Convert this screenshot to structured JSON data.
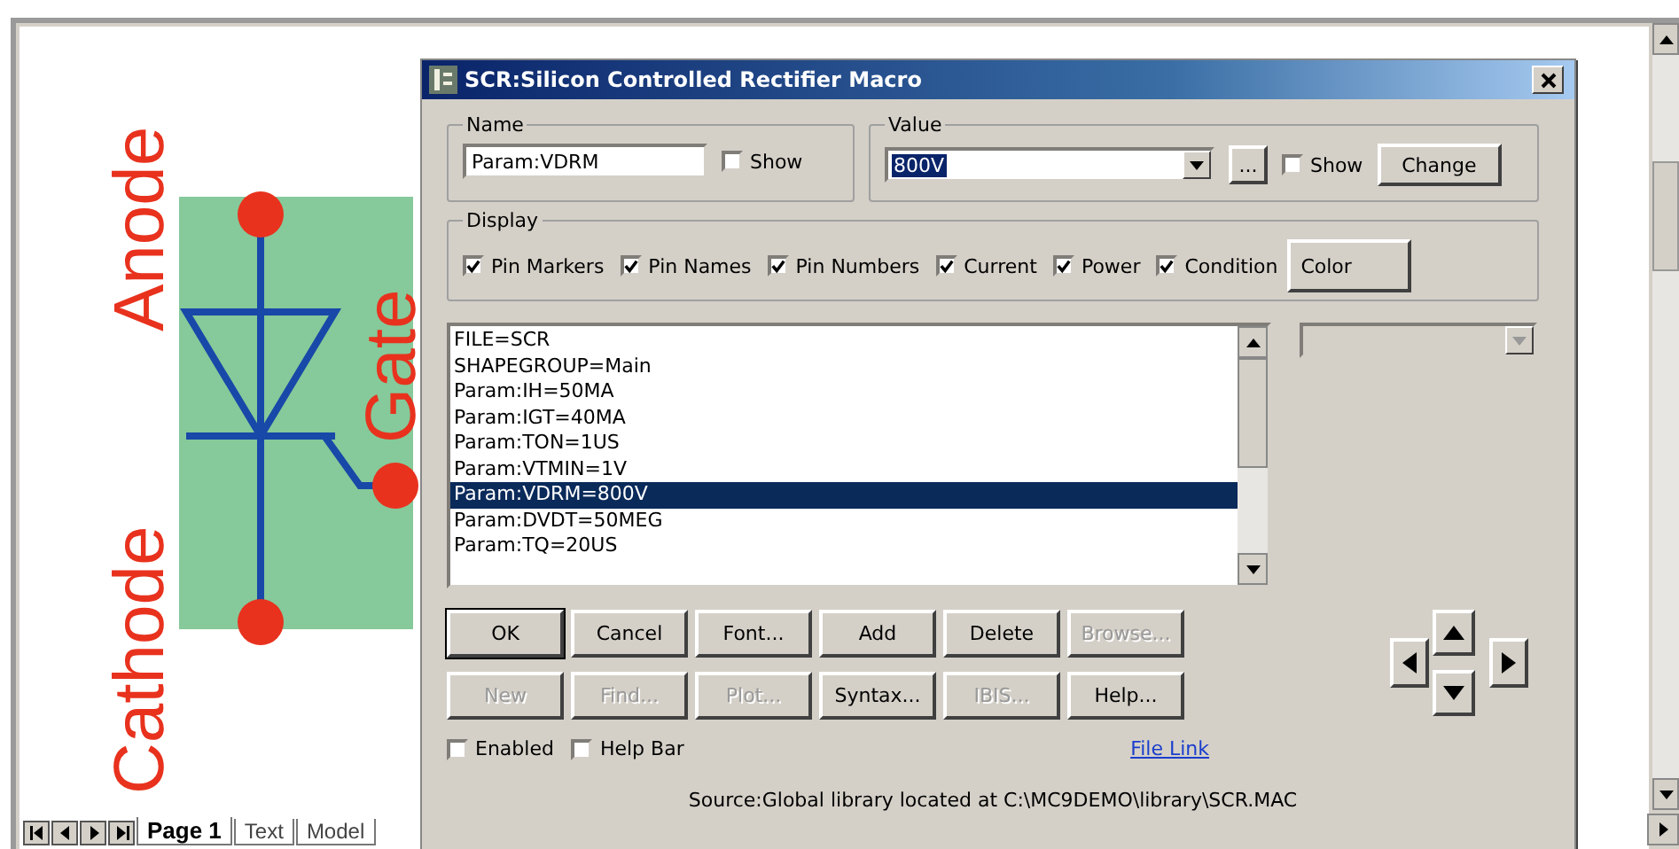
{
  "schematic": {
    "labels": [
      "Anode",
      "Gate",
      "Cathode"
    ]
  },
  "page_tabs": [
    {
      "label": "Page 1",
      "selected": true
    },
    {
      "label": "Text",
      "selected": false
    },
    {
      "label": "Model",
      "selected": false
    }
  ],
  "dialog": {
    "title": "SCR:Silicon Controlled Rectifier Macro",
    "name_group": {
      "legend": "Name",
      "value": "Param:VDRM",
      "show": {
        "label": "Show",
        "checked": false
      }
    },
    "value_group": {
      "legend": "Value",
      "value": "800V",
      "ellipsis": "...",
      "show": {
        "label": "Show",
        "checked": false
      },
      "button": "Change"
    },
    "display_group": {
      "legend": "Display",
      "options": [
        {
          "label": "Pin Markers",
          "checked": true
        },
        {
          "label": "Pin Names",
          "checked": true
        },
        {
          "label": "Pin Numbers",
          "checked": true
        },
        {
          "label": "Current",
          "checked": true
        },
        {
          "label": "Power",
          "checked": true
        },
        {
          "label": "Condition",
          "checked": true
        }
      ],
      "button": "Color"
    },
    "list_items": [
      {
        "text": "FILE=SCR",
        "selected": false
      },
      {
        "text": "SHAPEGROUP=Main",
        "selected": false
      },
      {
        "text": "Param:IH=50MA",
        "selected": false
      },
      {
        "text": "Param:IGT=40MA",
        "selected": false
      },
      {
        "text": "Param:TON=1US",
        "selected": false
      },
      {
        "text": "Param:VTMIN=1V",
        "selected": false
      },
      {
        "text": "Param:VDRM=800V",
        "selected": true
      },
      {
        "text": "Param:DVDT=50MEG",
        "selected": false
      },
      {
        "text": "Param:TQ=20US",
        "selected": false
      }
    ],
    "buttons": [
      [
        {
          "label": "OK",
          "disabled": false
        },
        {
          "label": "Cancel",
          "disabled": false
        },
        {
          "label": "Font...",
          "disabled": false
        },
        {
          "label": "Add",
          "disabled": false
        },
        {
          "label": "Delete",
          "disabled": false
        },
        {
          "label": "Browse...",
          "disabled": true
        }
      ],
      [
        {
          "label": "New",
          "disabled": true
        },
        {
          "label": "Find...",
          "disabled": true
        },
        {
          "label": "Plot...",
          "disabled": true
        },
        {
          "label": "Syntax...",
          "disabled": false
        },
        {
          "label": "IBIS...",
          "disabled": true
        },
        {
          "label": "Help...",
          "disabled": false
        }
      ]
    ],
    "options": [
      {
        "label": "Enabled",
        "checked": false
      },
      {
        "label": "Help Bar",
        "checked": false
      }
    ],
    "file_link": "File Link",
    "source": "Source:Global library located at C:\\MC9DEMO\\library\\SCR.MAC"
  }
}
